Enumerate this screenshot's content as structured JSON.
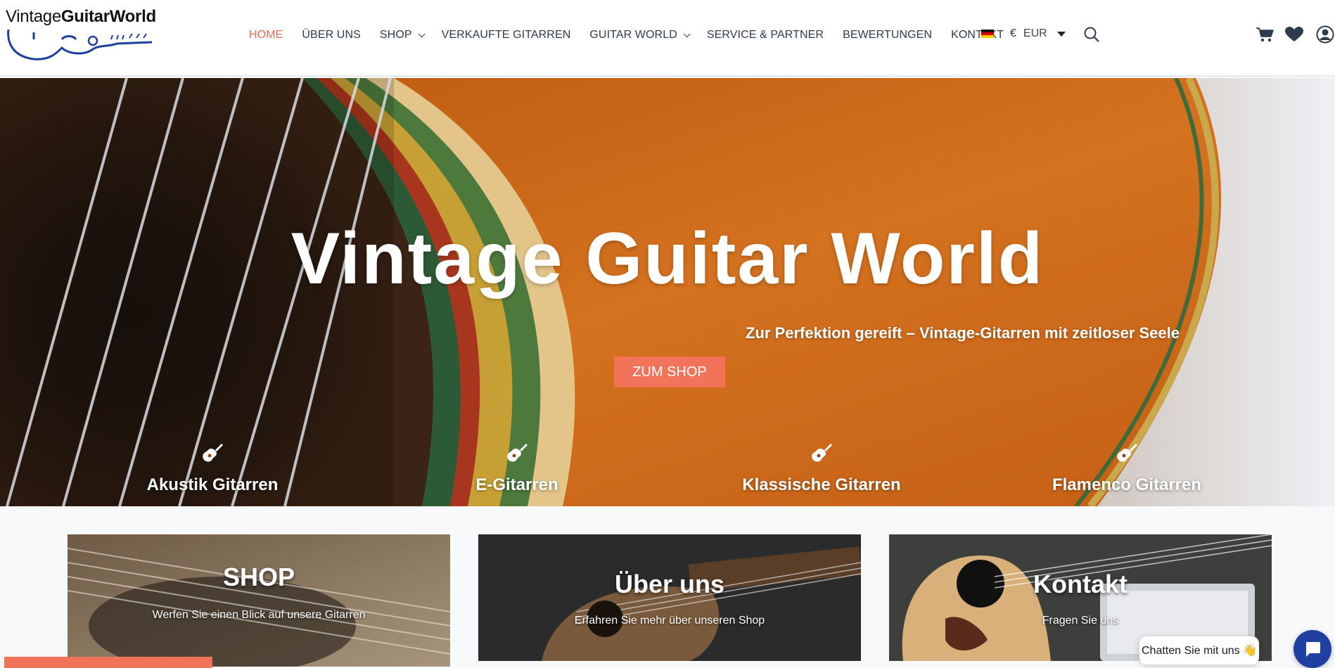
{
  "logo": {
    "text_light": "Vintage",
    "text_bold": "GuitarWorld"
  },
  "nav": {
    "items": [
      {
        "label": "HOME",
        "active": true,
        "dropdown": false
      },
      {
        "label": "ÜBER UNS",
        "active": false,
        "dropdown": false
      },
      {
        "label": "SHOP",
        "active": false,
        "dropdown": true
      },
      {
        "label": "VERKAUFTE GITARREN",
        "active": false,
        "dropdown": false
      },
      {
        "label": "GUITAR WORLD",
        "active": false,
        "dropdown": true
      },
      {
        "label": "SERVICE & PARTNER",
        "active": false,
        "dropdown": false
      },
      {
        "label": "BEWERTUNGEN",
        "active": false,
        "dropdown": false
      },
      {
        "label": "KONTAKT",
        "active": false,
        "dropdown": false
      }
    ]
  },
  "currency": {
    "symbol": "€",
    "code": "EUR",
    "flag": "germany-flag-icon"
  },
  "icons": [
    "search-icon",
    "cart-icon",
    "heart-icon",
    "account-icon"
  ],
  "hero": {
    "title": "Vintage Guitar World",
    "subtitle": "Zur Perfektion gereift – Vintage-Gitarren mit zeitloser Seele",
    "cta": "ZUM SHOP",
    "categories": [
      {
        "label": "Akustik Gitarren",
        "icon": "guitar-icon"
      },
      {
        "label": "E-Gitarren",
        "icon": "guitar-icon"
      },
      {
        "label": "Klassische Gitarren",
        "icon": "guitar-icon"
      },
      {
        "label": "Flamenco Gitarren",
        "icon": "guitar-icon"
      }
    ]
  },
  "cards": [
    {
      "title": "SHOP",
      "text": "Werfen Sie einen Blick auf unsere Gitarren"
    },
    {
      "title": "Über uns",
      "text": "Erfahren Sie mehr über unseren Shop"
    },
    {
      "title": "Kontakt",
      "text": "Fragen Sie uns"
    }
  ],
  "chat": {
    "label": "Chatten Sie mit uns 👋"
  },
  "colors": {
    "accent": "#f0735a",
    "nav_text": "#2d3b4f",
    "chat_button": "#1f3fa3",
    "logo_blue": "#1d3f9e"
  }
}
